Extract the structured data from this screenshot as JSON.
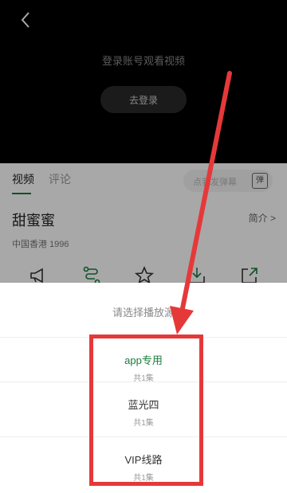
{
  "player": {
    "login_prompt": "登录账号观看视频",
    "login_button": "去登录"
  },
  "tabs": [
    {
      "label": "视频"
    },
    {
      "label": "评论"
    }
  ],
  "danmaku": {
    "placeholder": "点我发弹幕",
    "toggle": "弹"
  },
  "movie": {
    "title": "甜蜜蜜",
    "intro": "简介 >",
    "meta": "中国香港   1996"
  },
  "action_icons": [
    "megaphone-icon",
    "route-icon",
    "star-icon",
    "download-icon",
    "share-icon"
  ],
  "sheet": {
    "title": "请选择播放源",
    "sources": [
      {
        "name": "app专用",
        "count": "共1集"
      },
      {
        "name": "蓝光四",
        "count": "共1集"
      },
      {
        "name": "VIP线路",
        "count": "共1集"
      }
    ]
  },
  "colors": {
    "accent": "#1a7b3c",
    "annotation": "#e53939"
  }
}
